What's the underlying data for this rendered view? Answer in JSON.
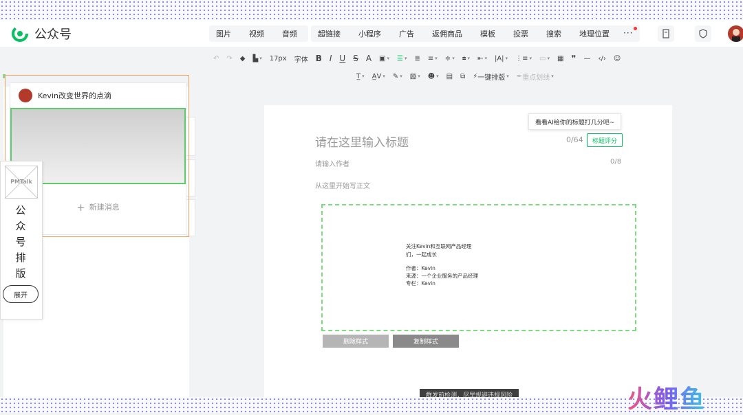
{
  "app": {
    "name": "公众号"
  },
  "nav": {
    "group1": [
      "图片",
      "视频",
      "音频"
    ],
    "group2": [
      "超链接",
      "小程序",
      "广告",
      "返佣商品",
      "模板",
      "投票",
      "搜索",
      "地理位置"
    ],
    "more": "···"
  },
  "toolbar": {
    "row1": [
      "17px",
      "字体",
      "B",
      "I",
      "U",
      "S",
      "A"
    ],
    "row2_actions": [
      "一键排版",
      "重点划线"
    ]
  },
  "card": {
    "account_name": "Kevin改变世界的点滴",
    "new_message": "新建消息"
  },
  "pm": {
    "image_alt": "PMTalk",
    "vertical_text": [
      "公",
      "众",
      "号",
      "排",
      "版"
    ],
    "expand": "展开"
  },
  "editor": {
    "tooltip": "看看AI给你的标题打几分吧~",
    "title_placeholder": "请在这里输入标题",
    "title_count": "0/64",
    "score_button": "标题评分",
    "author_placeholder": "请输入作者",
    "author_count": "0/8",
    "body_placeholder": "从这里开始写正文",
    "template": {
      "line1": "关注Kevin和互联网产品经理",
      "line2": "们，一起成长",
      "author": "作者：Kevin",
      "source": "来源：一个企业服务的产品经理",
      "column": "专栏：Kevin"
    },
    "delete_style": "删除样式",
    "copy_style": "复制样式",
    "bottom_notice": "群发前检测，尽早规避违规风险"
  },
  "watermark": "火鲤鱼",
  "colors": {
    "brand_green": "#07c160",
    "dash_green": "#7ddc7d",
    "highlight_orange": "#f0a061"
  }
}
